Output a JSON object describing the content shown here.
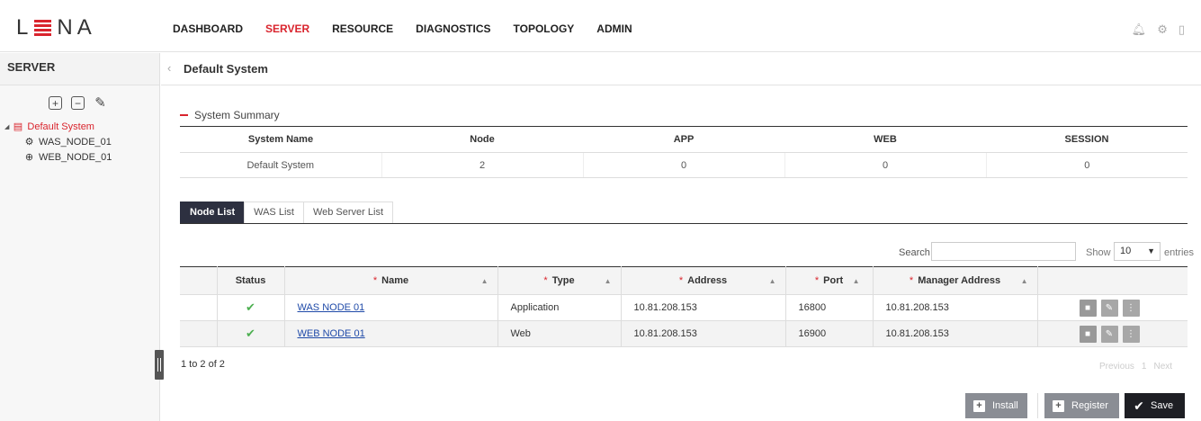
{
  "app": {
    "logo": {
      "left": "L",
      "right": "NA"
    }
  },
  "nav": {
    "items": [
      {
        "label": "DASHBOARD",
        "active": false
      },
      {
        "label": "SERVER",
        "active": true
      },
      {
        "label": "RESOURCE",
        "active": false
      },
      {
        "label": "DIAGNOSTICS",
        "active": false
      },
      {
        "label": "TOPOLOGY",
        "active": false
      },
      {
        "label": "ADMIN",
        "active": false
      }
    ],
    "icons": [
      "bell-icon",
      "gear-icon",
      "logout-icon"
    ]
  },
  "sidebar": {
    "title": "SERVER",
    "tools": [
      "add-icon",
      "remove-icon",
      "edit-icon"
    ],
    "tree": {
      "root": "Default System",
      "children": [
        {
          "label": "WAS_NODE_01",
          "icon": "was-node-icon"
        },
        {
          "label": "WEB_NODE_01",
          "icon": "web-node-icon"
        }
      ]
    }
  },
  "header": {
    "title": "Default System"
  },
  "summary": {
    "heading": "System Summary",
    "columns": [
      "System Name",
      "Node",
      "APP",
      "WEB",
      "SESSION"
    ],
    "row": [
      "Default System",
      "2",
      "0",
      "0",
      "0"
    ]
  },
  "tabs": [
    {
      "label": "Node List",
      "active": true
    },
    {
      "label": "WAS List",
      "active": false
    },
    {
      "label": "Web Server List",
      "active": false
    }
  ],
  "table_controls": {
    "search_label": "Search",
    "search_value": "",
    "show_label": "Show",
    "show_value": "10",
    "entries_label": "entries"
  },
  "node_table": {
    "columns": [
      "Status",
      "Name",
      "Type",
      "Address",
      "Port",
      "Manager Address"
    ],
    "rows": [
      {
        "status": "✔",
        "name": "WAS NODE 01",
        "type": "Application",
        "address": "10.81.208.153",
        "port": "16800",
        "manager_address": "10.81.208.153"
      },
      {
        "status": "✔",
        "name": "WEB NODE 01",
        "type": "Web",
        "address": "10.81.208.153",
        "port": "16900",
        "manager_address": "10.81.208.153"
      }
    ]
  },
  "pagination": {
    "count_text": "1 to 2 of 2",
    "previous": "Previous",
    "page": "1",
    "next": "Next"
  },
  "actions": {
    "install": "Install",
    "register": "Register",
    "save": "Save"
  },
  "colors": {
    "accent": "#d9242d",
    "tab_active": "#2d3040",
    "link": "#1f4aa8",
    "check": "#4caf50"
  }
}
